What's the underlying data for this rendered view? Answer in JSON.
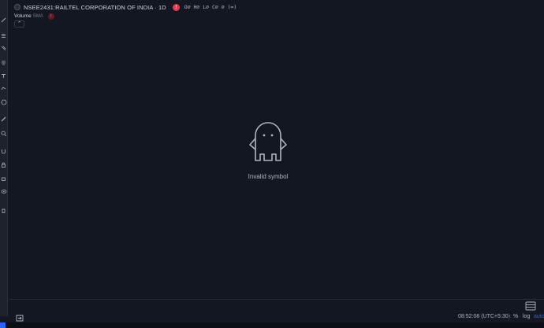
{
  "legend": {
    "symbol_title": "NSEE2431:RAILTEL CORPORATION OF INDIA · 1D",
    "error_mark": "!",
    "ohlc": "O∅ H∅ L∅ C∅ ∅ (∞)"
  },
  "indicator": {
    "name": "Volume",
    "subtitle": "SMA",
    "error_mark": "!"
  },
  "collapse_glyph": "⌃",
  "empty_state": {
    "message": "Invalid symbol"
  },
  "bottom_bar": {
    "clock": "08:52:08 (UTC+5:30)",
    "percent_label": "%",
    "log_label": "log",
    "auto_label": "auto"
  },
  "colors": {
    "background": "#131722",
    "toolbar": "#1e222d",
    "accent": "#2962ff",
    "error": "#f23645",
    "text": "#d1d4dc",
    "muted": "#787b86"
  }
}
